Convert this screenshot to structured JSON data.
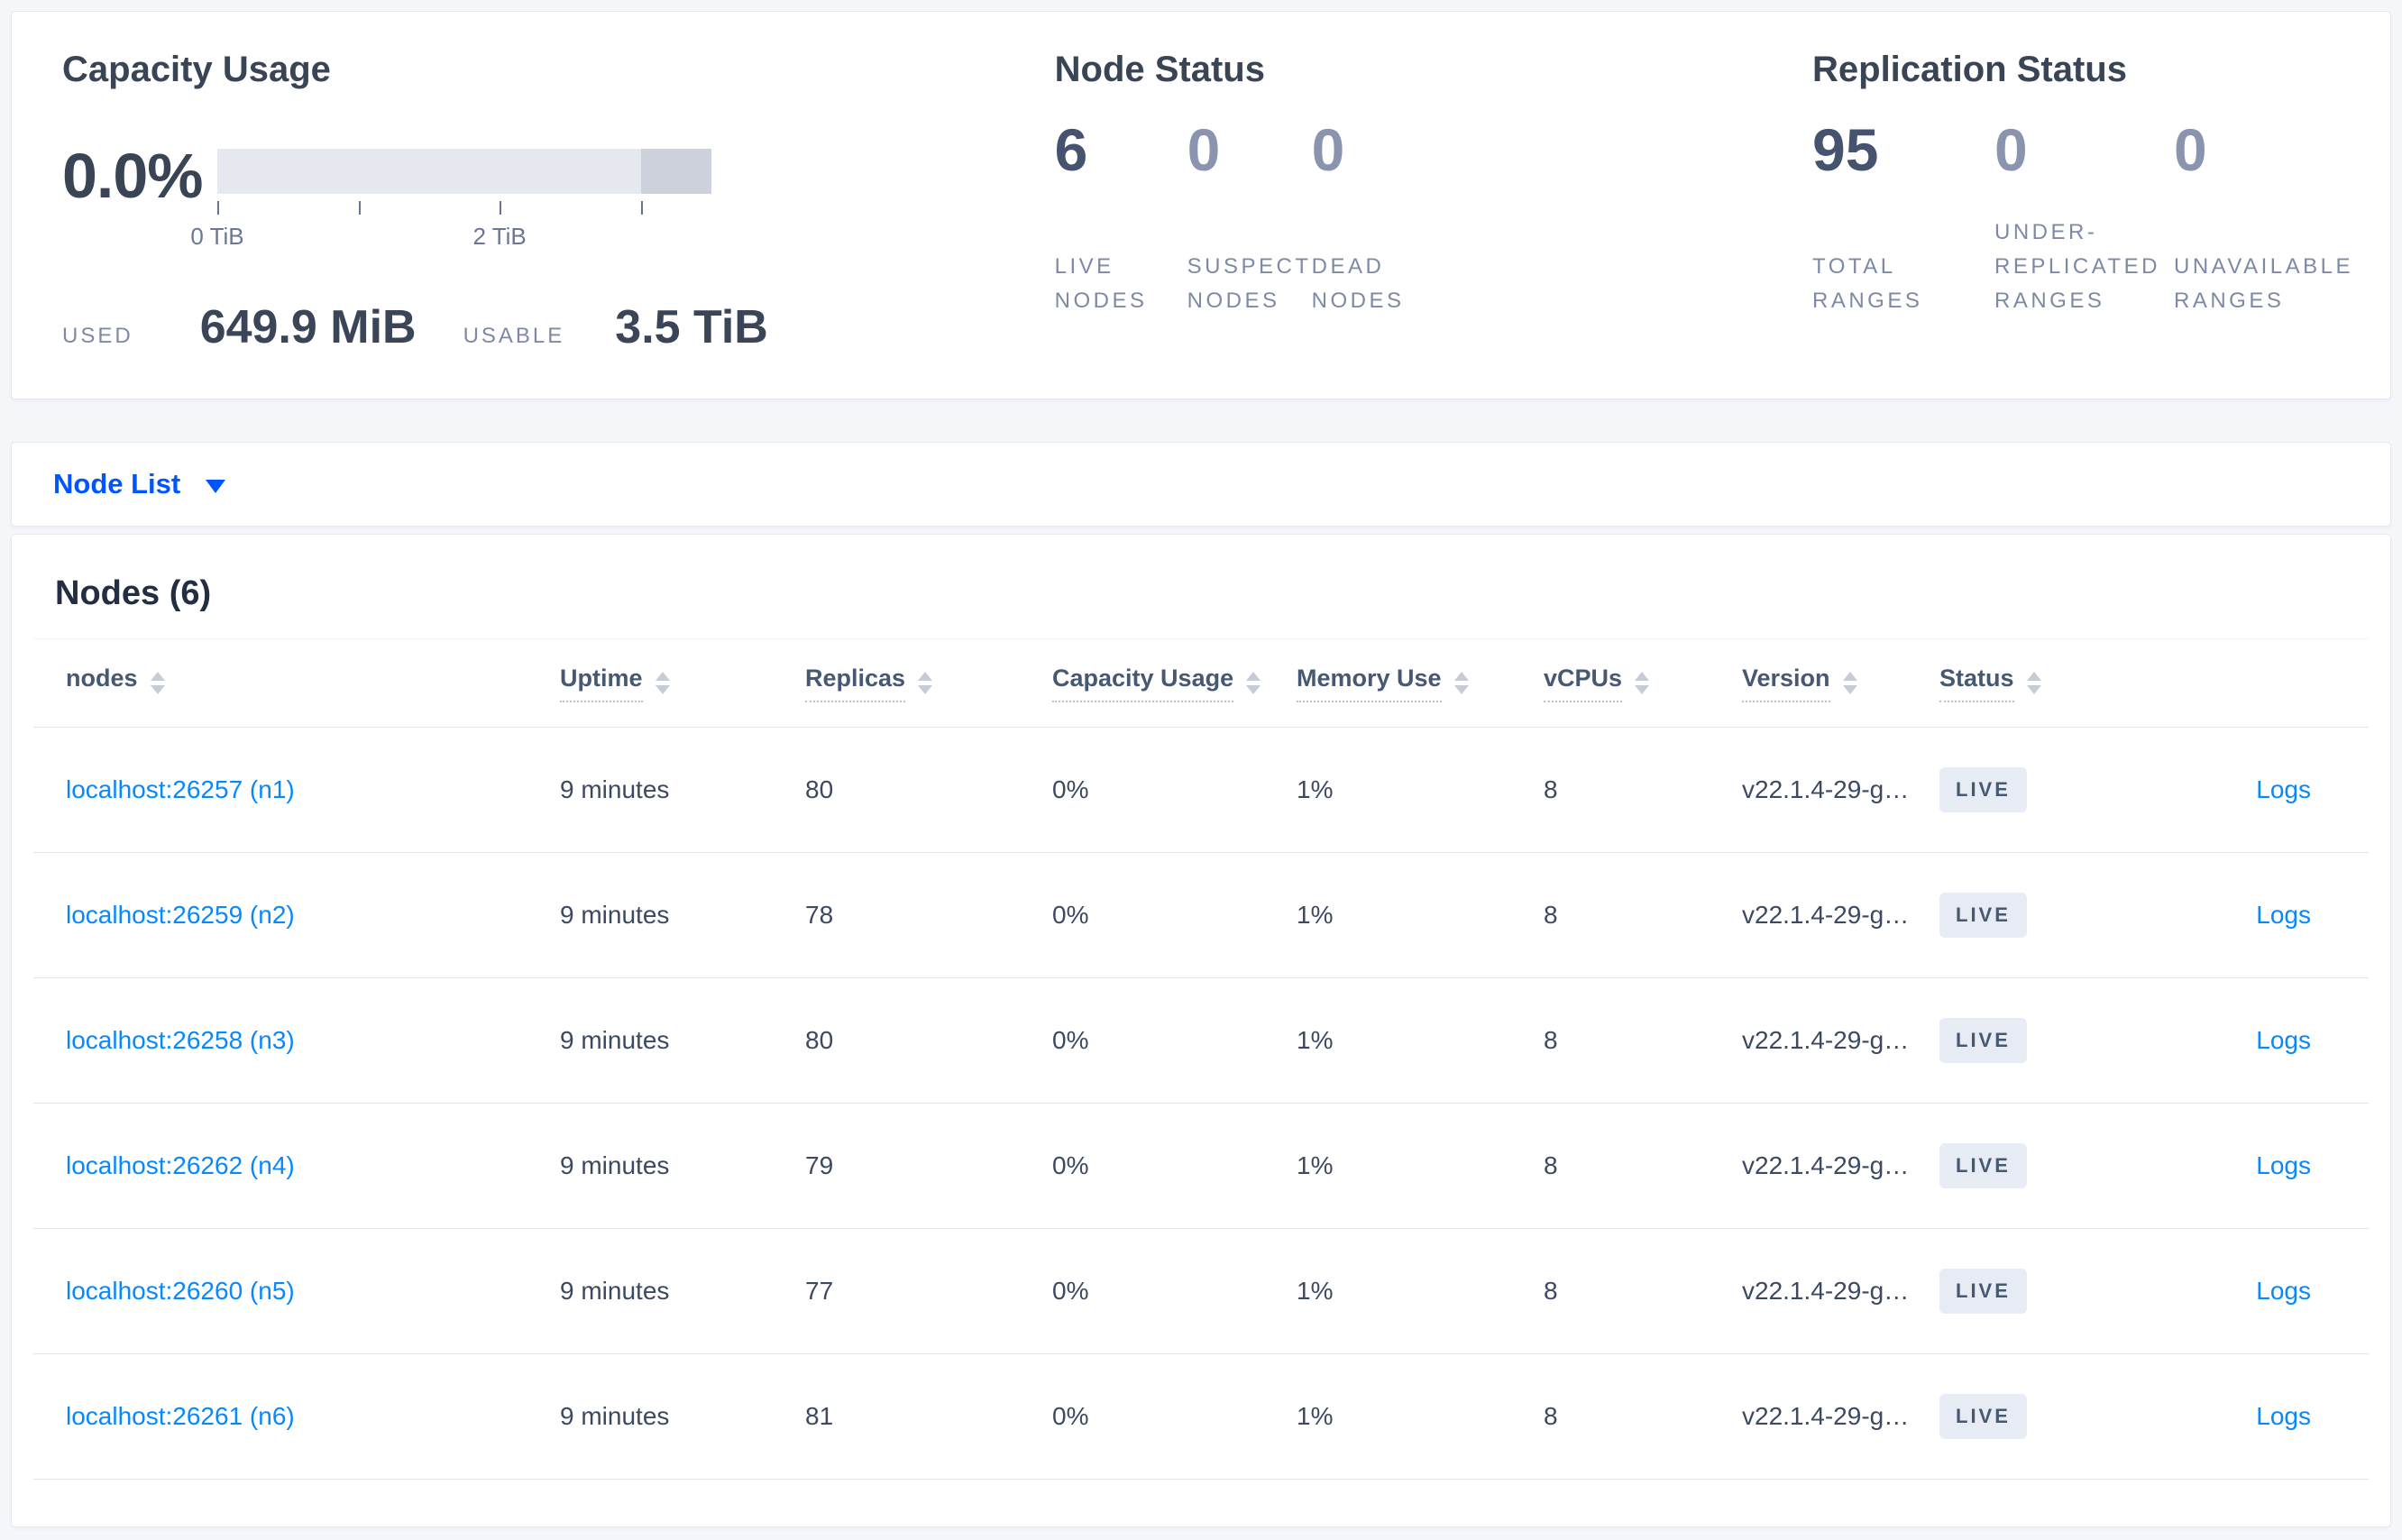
{
  "colors": {
    "page_background": "#f4f6fa",
    "primary_blue": "#0055ff",
    "link_blue": "#0788ff",
    "dark_text": "#394455",
    "muted_label": "#7d89a5",
    "muted_zero": "#8a94af",
    "bar_light": "#e5e8ee",
    "bar_dark": "#ccd1db",
    "badge_background": "#e7ebf3",
    "badge_text": "#475872"
  },
  "capacity": {
    "title": "Capacity Usage",
    "percent": "0.0%",
    "used_label": "USED",
    "used_value": "649.9 MiB",
    "usable_label": "USABLE",
    "usable_value": "3.5 TiB",
    "bar": {
      "dark_segment_pct": 14.29,
      "ticks": [
        {
          "pos_pct": 0,
          "label": "0 TiB"
        },
        {
          "pos_pct": 28.57,
          "label": ""
        },
        {
          "pos_pct": 57.14,
          "label": "2 TiB"
        },
        {
          "pos_pct": 85.71,
          "label": ""
        }
      ]
    }
  },
  "node_status": {
    "title": "Node Status",
    "stats": [
      {
        "value": "6",
        "label": "LIVE NODES"
      },
      {
        "value": "0",
        "label": "SUSPECT NODES"
      },
      {
        "value": "0",
        "label": "DEAD NODES"
      }
    ]
  },
  "replication_status": {
    "title": "Replication Status",
    "stats": [
      {
        "value": "95",
        "label": "TOTAL RANGES"
      },
      {
        "value": "0",
        "label": "UNDER-REPLICATED RANGES"
      },
      {
        "value": "0",
        "label": "UNAVAILABLE RANGES"
      }
    ]
  },
  "view_selector": {
    "label": "Node List"
  },
  "nodes_section": {
    "title": "Nodes (6)"
  },
  "table": {
    "columns": [
      {
        "label": "nodes"
      },
      {
        "label": "Uptime"
      },
      {
        "label": "Replicas"
      },
      {
        "label": "Capacity Usage"
      },
      {
        "label": "Memory Use"
      },
      {
        "label": "vCPUs"
      },
      {
        "label": "Version"
      },
      {
        "label": "Status"
      }
    ],
    "rows": [
      {
        "node": "localhost:26257 (n1)",
        "uptime": "9 minutes",
        "replicas": "80",
        "capacity": "0%",
        "memory": "1%",
        "vcpus": "8",
        "version": "v22.1.4-29-g…",
        "status": "LIVE",
        "logs": "Logs"
      },
      {
        "node": "localhost:26259 (n2)",
        "uptime": "9 minutes",
        "replicas": "78",
        "capacity": "0%",
        "memory": "1%",
        "vcpus": "8",
        "version": "v22.1.4-29-g…",
        "status": "LIVE",
        "logs": "Logs"
      },
      {
        "node": "localhost:26258 (n3)",
        "uptime": "9 minutes",
        "replicas": "80",
        "capacity": "0%",
        "memory": "1%",
        "vcpus": "8",
        "version": "v22.1.4-29-g…",
        "status": "LIVE",
        "logs": "Logs"
      },
      {
        "node": "localhost:26262 (n4)",
        "uptime": "9 minutes",
        "replicas": "79",
        "capacity": "0%",
        "memory": "1%",
        "vcpus": "8",
        "version": "v22.1.4-29-g…",
        "status": "LIVE",
        "logs": "Logs"
      },
      {
        "node": "localhost:26260 (n5)",
        "uptime": "9 minutes",
        "replicas": "77",
        "capacity": "0%",
        "memory": "1%",
        "vcpus": "8",
        "version": "v22.1.4-29-g…",
        "status": "LIVE",
        "logs": "Logs"
      },
      {
        "node": "localhost:26261 (n6)",
        "uptime": "9 minutes",
        "replicas": "81",
        "capacity": "0%",
        "memory": "1%",
        "vcpus": "8",
        "version": "v22.1.4-29-g…",
        "status": "LIVE",
        "logs": "Logs"
      }
    ]
  }
}
